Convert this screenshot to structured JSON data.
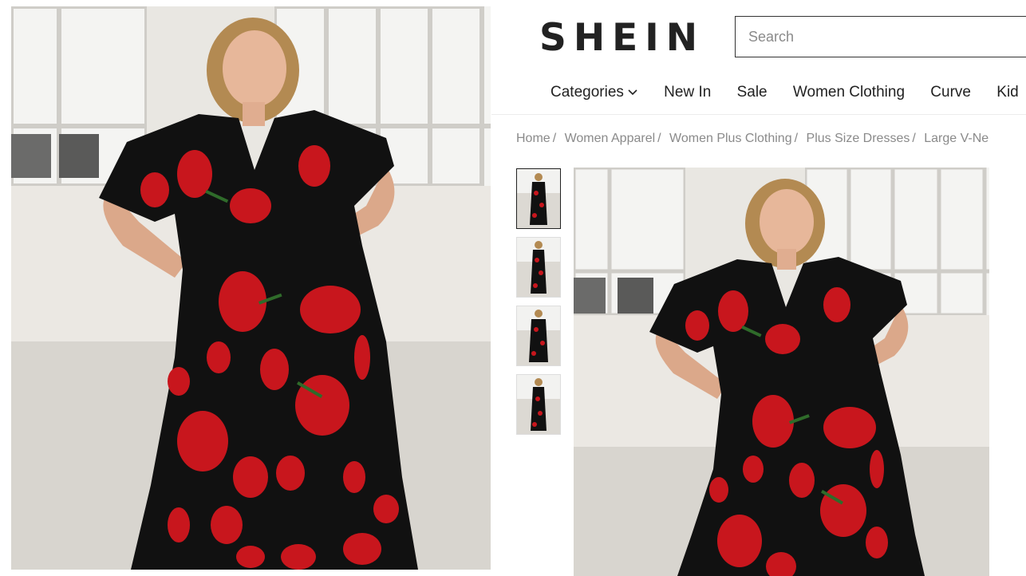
{
  "header": {
    "logo": "SHEIN",
    "search_placeholder": "Search"
  },
  "nav": {
    "items": [
      "Categories",
      "New In",
      "Sale",
      "Women Clothing",
      "Curve",
      "Kid"
    ]
  },
  "breadcrumb": {
    "items": [
      "Home",
      "Women Apparel",
      "Women Plus Clothing",
      "Plus Size Dresses",
      "Large V-Ne"
    ]
  },
  "gallery": {
    "thumbnail_count": 4,
    "active_thumbnail": 1
  },
  "colors": {
    "dress": "#111111",
    "flower": "#c8161d",
    "wall": "#ebe8e3",
    "floor": "#d9d6d0"
  }
}
